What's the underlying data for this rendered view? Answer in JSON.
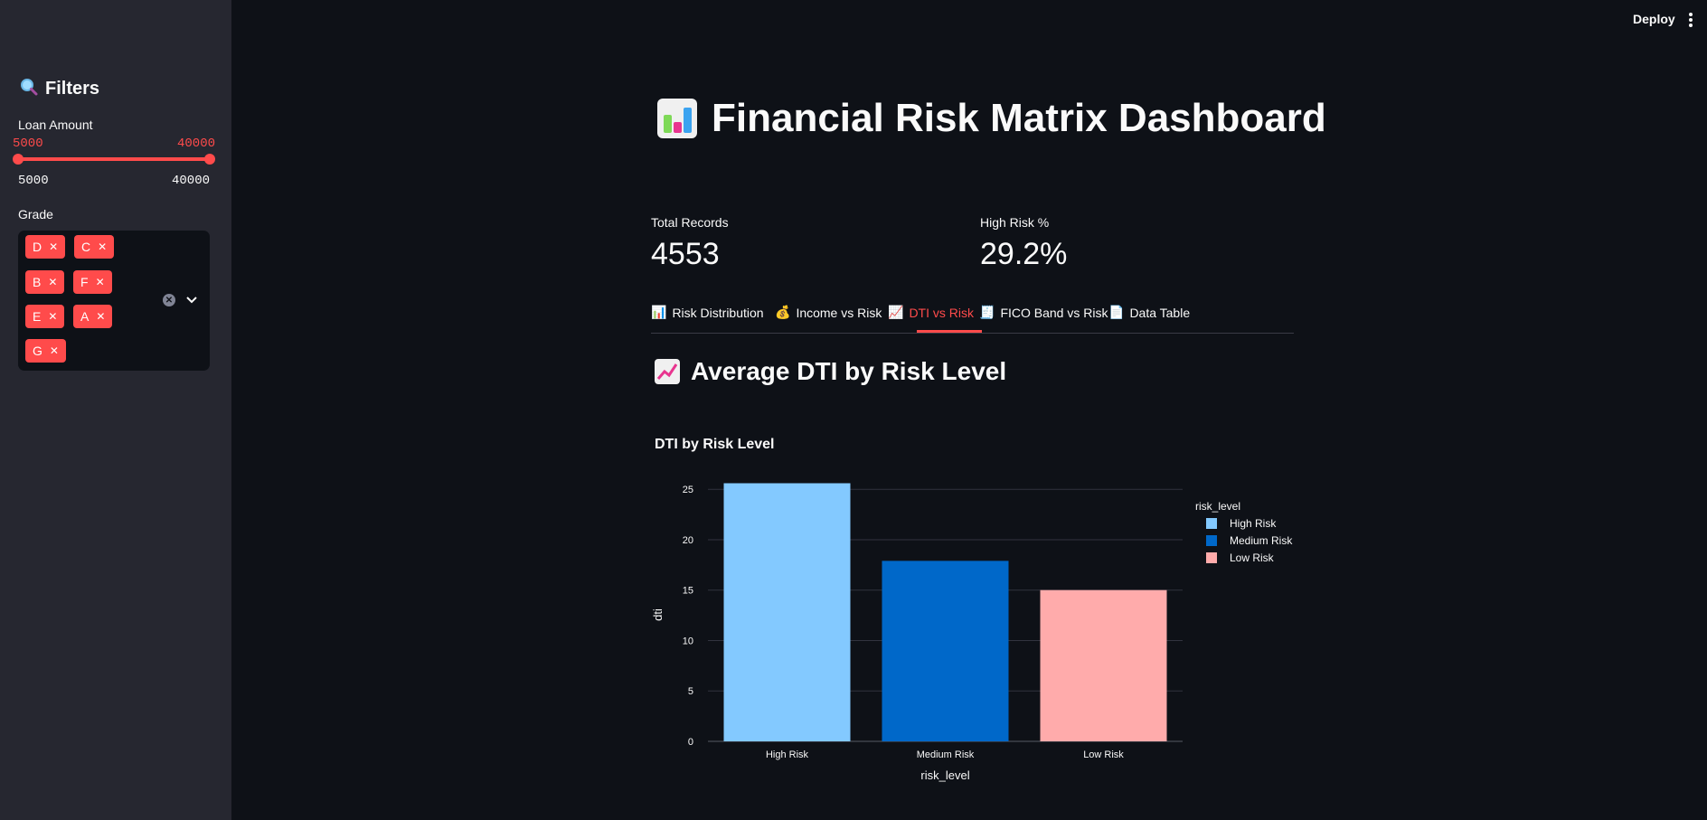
{
  "topbar": {
    "deploy_label": "Deploy"
  },
  "sidebar": {
    "title": "Filters",
    "loan_amount": {
      "label": "Loan Amount",
      "selected_min": "5000",
      "selected_max": "40000",
      "range_min": "5000",
      "range_max": "40000"
    },
    "grade": {
      "label": "Grade",
      "chips": [
        "D",
        "C",
        "B",
        "F",
        "E",
        "A",
        "G"
      ]
    }
  },
  "main": {
    "title": "Financial Risk Matrix Dashboard",
    "metrics": [
      {
        "label": "Total Records",
        "value": "4553"
      },
      {
        "label": "High Risk %",
        "value": "29.2%"
      }
    ],
    "tabs": [
      {
        "icon": "bar-chart-icon",
        "label": "Risk Distribution"
      },
      {
        "icon": "money-bag-icon",
        "label": "Income vs Risk"
      },
      {
        "icon": "trend-up-icon",
        "label": "DTI vs Risk"
      },
      {
        "icon": "receipt-icon",
        "label": "FICO Band vs Risk"
      },
      {
        "icon": "document-icon",
        "label": "Data Table"
      }
    ],
    "active_tab": "DTI vs Risk",
    "section_title": "Average DTI by Risk Level"
  },
  "chart_data": {
    "type": "bar",
    "title": "DTI by Risk Level",
    "xlabel": "risk_level",
    "ylabel": "dti",
    "categories": [
      "High Risk",
      "Medium Risk",
      "Low Risk"
    ],
    "values": [
      25.6,
      17.9,
      15.0
    ],
    "colors": [
      "#83c9ff",
      "#0068c9",
      "#ffabab"
    ],
    "yticks": [
      0,
      5,
      10,
      15,
      20,
      25
    ],
    "ylim": [
      0,
      26.9
    ],
    "legend_title": "risk_level",
    "legend_placement": "right",
    "grid": true
  }
}
